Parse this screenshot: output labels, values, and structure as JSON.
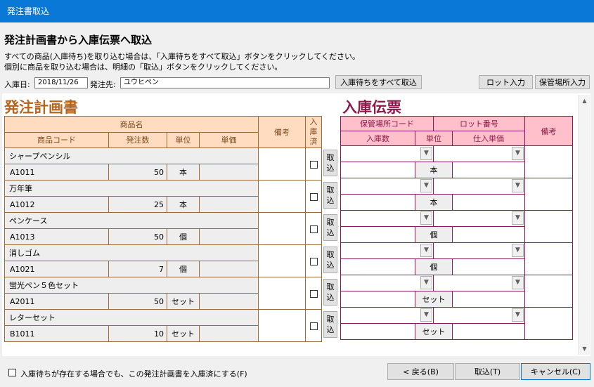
{
  "window_title": "発注書取込",
  "heading": "発注計画書から入庫伝票へ取込",
  "instructions": [
    "すべての商品(入庫待ち)を取り込む場合は、「入庫待ちをすべて取込」ボタンをクリックしてください。",
    "個別に商品を取り込む場合は、明細の「取込」ボタンをクリックしてください。"
  ],
  "form": {
    "date_label": "入庫日:",
    "date_value": "2018/11/26",
    "vendor_label": "発注先:",
    "vendor_value": "ユウヒペン",
    "import_all_button": "入庫待ちをすべて取込",
    "lot_button": "ロット入力",
    "location_button": "保管場所入力"
  },
  "order_plan": {
    "title": "発注計画書",
    "headers": {
      "product_name": "商品名",
      "memo": "備考",
      "received": "入庫済",
      "product_code": "商品コード",
      "quantity": "発注数",
      "unit": "単位",
      "price": "単価"
    },
    "rows": [
      {
        "name": "シャープペンシル",
        "code": "A1011",
        "qty": "50",
        "unit": "本"
      },
      {
        "name": "万年筆",
        "code": "A1012",
        "qty": "25",
        "unit": "本"
      },
      {
        "name": "ペンケース",
        "code": "A1013",
        "qty": "50",
        "unit": "個"
      },
      {
        "name": "消しゴム",
        "code": "A1021",
        "qty": "7",
        "unit": "個"
      },
      {
        "name": "蛍光ペン５色セット",
        "code": "A2011",
        "qty": "50",
        "unit": "セット"
      },
      {
        "name": "レターセット",
        "code": "B1011",
        "qty": "10",
        "unit": "セット"
      }
    ],
    "import_row_button": "取込"
  },
  "receipt": {
    "title": "入庫伝票",
    "headers": {
      "location_code": "保管場所コード",
      "lot_number": "ロット番号",
      "memo": "備考",
      "quantity": "入庫数",
      "unit": "単位",
      "unit_price": "仕入単価"
    },
    "units": [
      "本",
      "本",
      "個",
      "個",
      "セット",
      "セット"
    ]
  },
  "footer": {
    "checkbox_label": "入庫待ちが存在する場合でも、この発注計画書を入庫済にする(F)",
    "back_button": "< 戻る(B)",
    "import_button": "取込(T)",
    "cancel_button": "キャンセル(C)"
  },
  "icons": {
    "dropdown": "chevron-down-icon",
    "scroll_up": "scroll-up-arrow-icon",
    "scroll_down": "scroll-down-arrow-icon"
  }
}
